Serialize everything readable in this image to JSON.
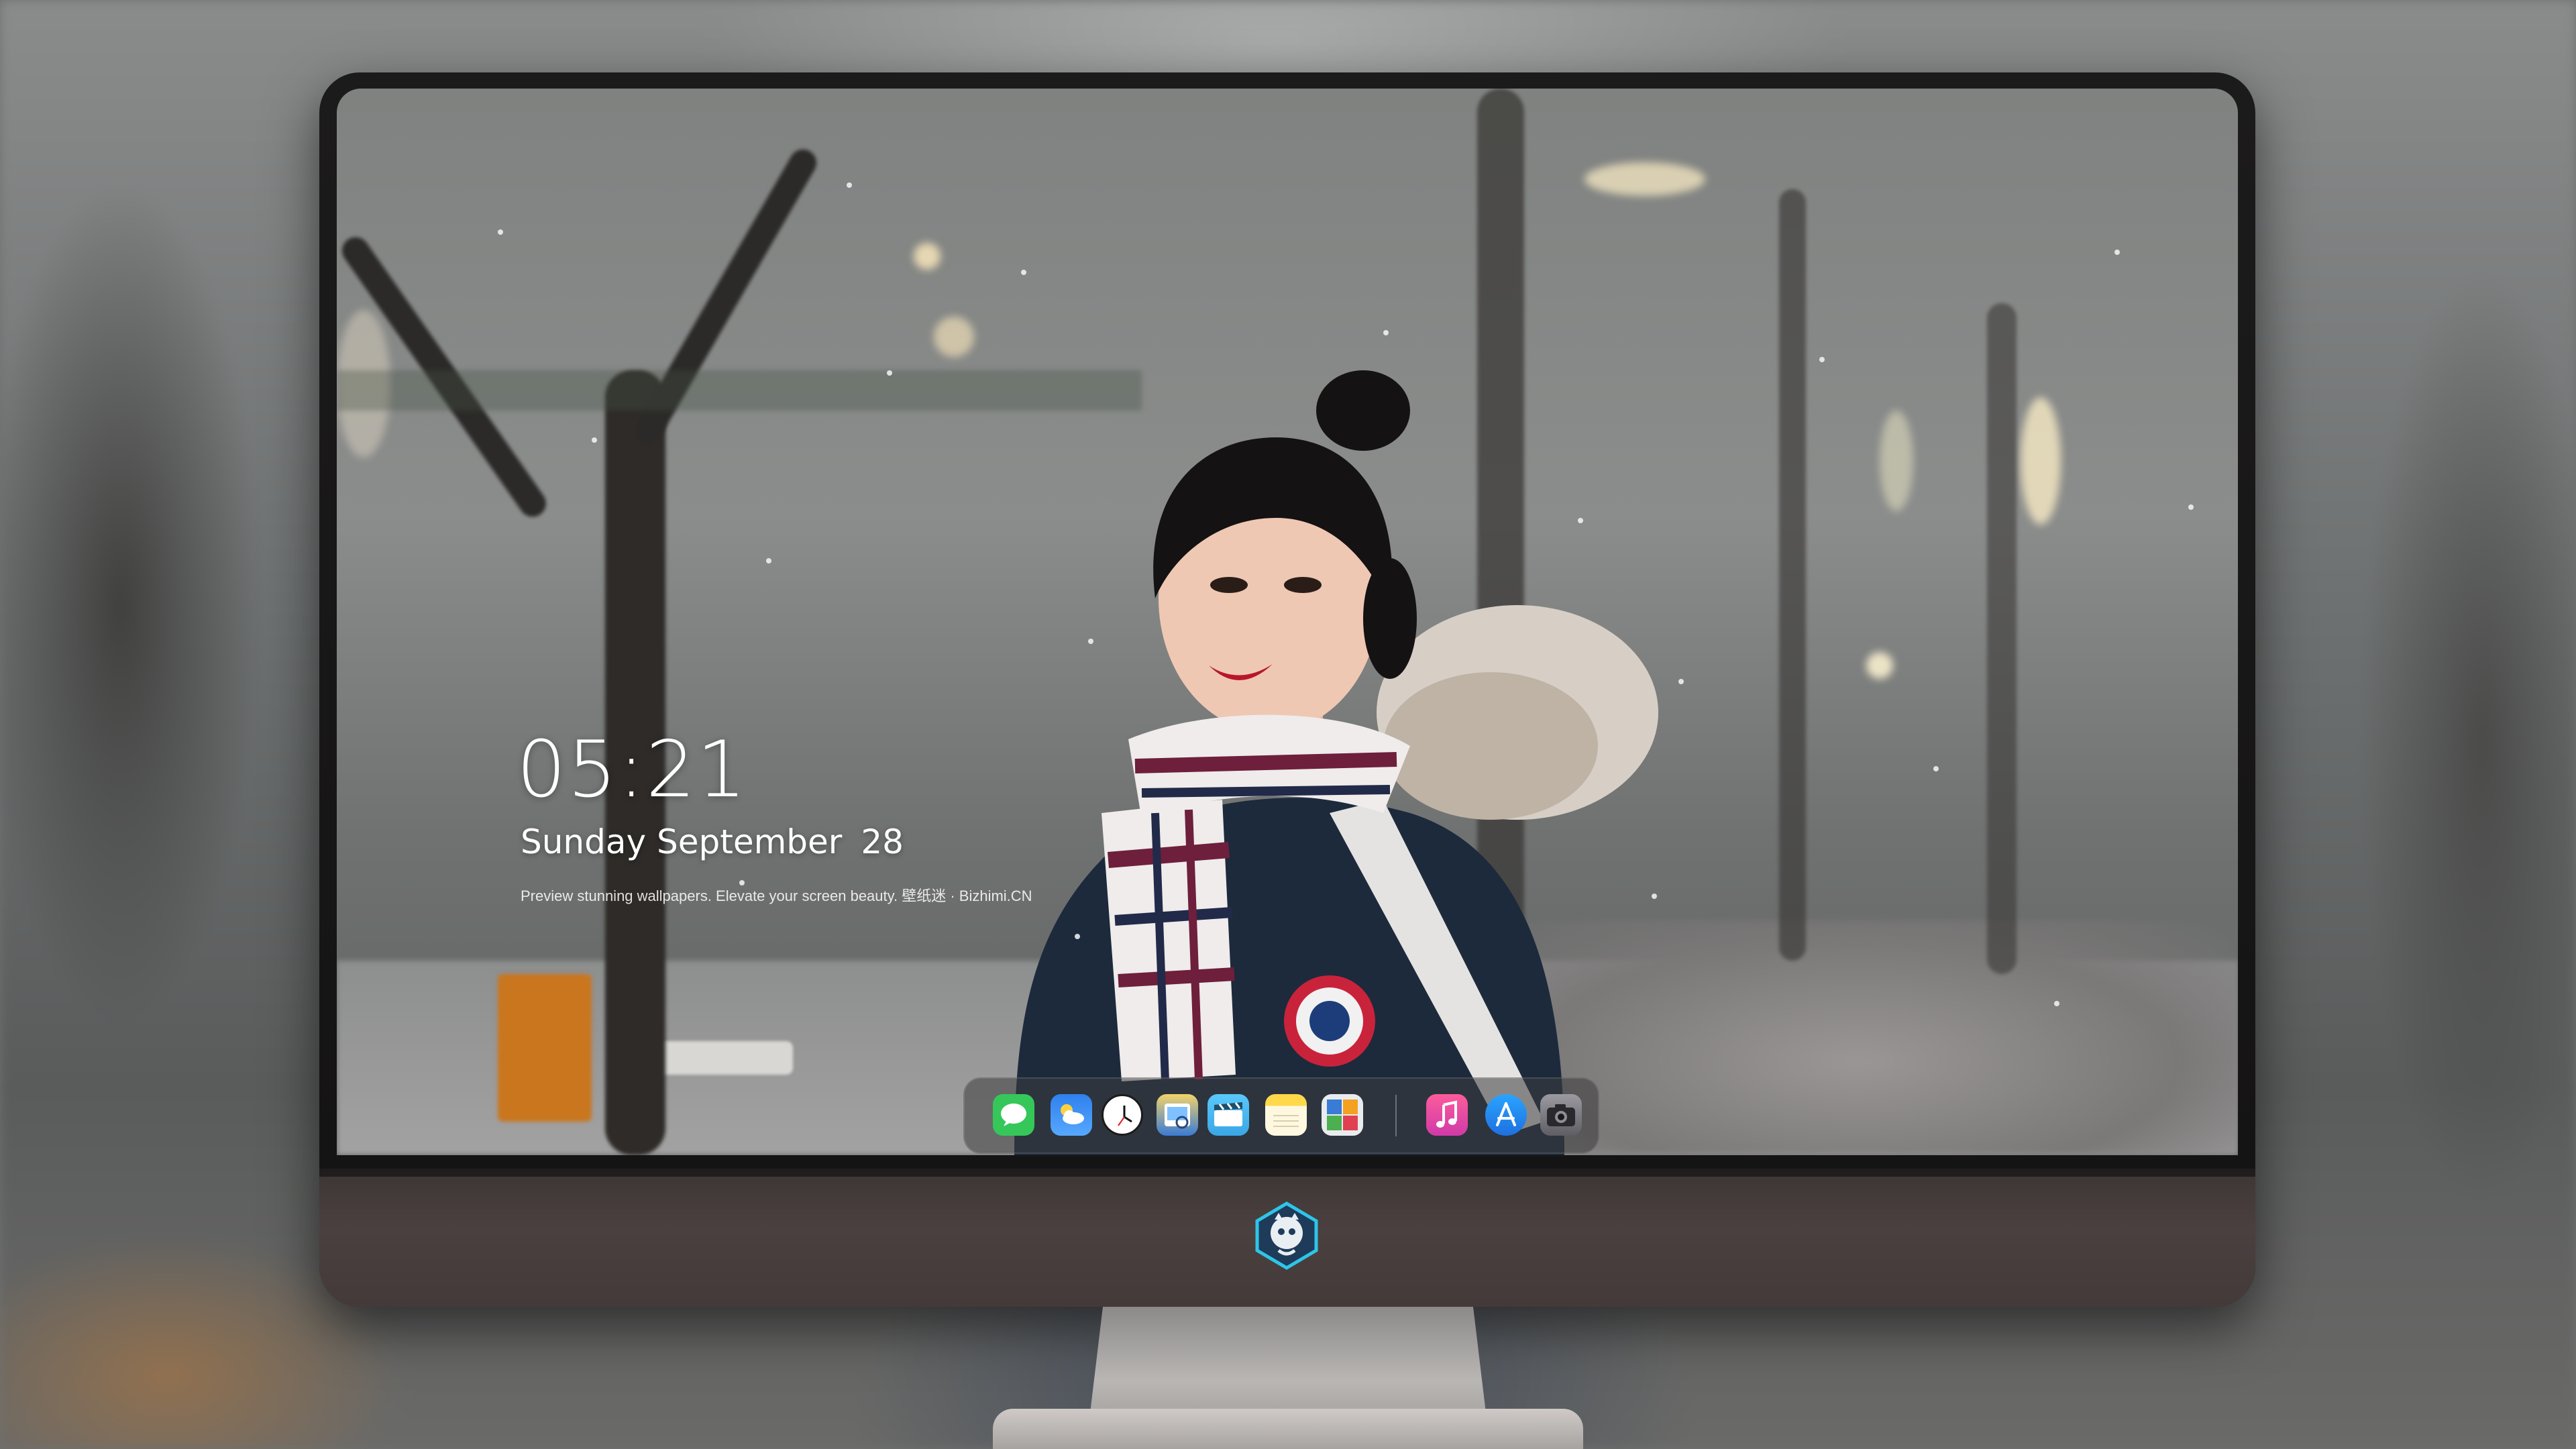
{
  "lock_screen": {
    "time": "05:21",
    "weekday_month": "Sunday September",
    "day": "28",
    "tagline": "Preview stunning wallpapers. Elevate your screen beauty. 壁纸迷 · Bizhimi.CN"
  },
  "dock": {
    "apps": [
      {
        "name": "Messages",
        "icon": "messages-icon",
        "color": "#35c759"
      },
      {
        "name": "Weather",
        "icon": "weather-icon",
        "color": "#2f80ed"
      },
      {
        "name": "Clock",
        "icon": "clock-icon",
        "color": "#ffffff"
      },
      {
        "name": "Preview",
        "icon": "preview-icon",
        "color": "#e3b93c"
      },
      {
        "name": "Clips",
        "icon": "clips-icon",
        "color": "#5ac8fa"
      },
      {
        "name": "Notes",
        "icon": "notes-icon",
        "color": "#ffd94a"
      },
      {
        "name": "Photo Booth",
        "icon": "photo-booth-icon",
        "color": "#3a7bd5"
      },
      {
        "name": "Music",
        "icon": "music-icon",
        "color": "#fc3c8d"
      },
      {
        "name": "App Store",
        "icon": "app-store-icon",
        "color": "#1e90ff"
      },
      {
        "name": "Camera",
        "icon": "camera-icon",
        "color": "#8e8e93"
      }
    ]
  },
  "monitor": {
    "logo_icon": "mascot-logo-icon",
    "bezel_color": "#1a1919",
    "chin_color": "#433a39"
  }
}
